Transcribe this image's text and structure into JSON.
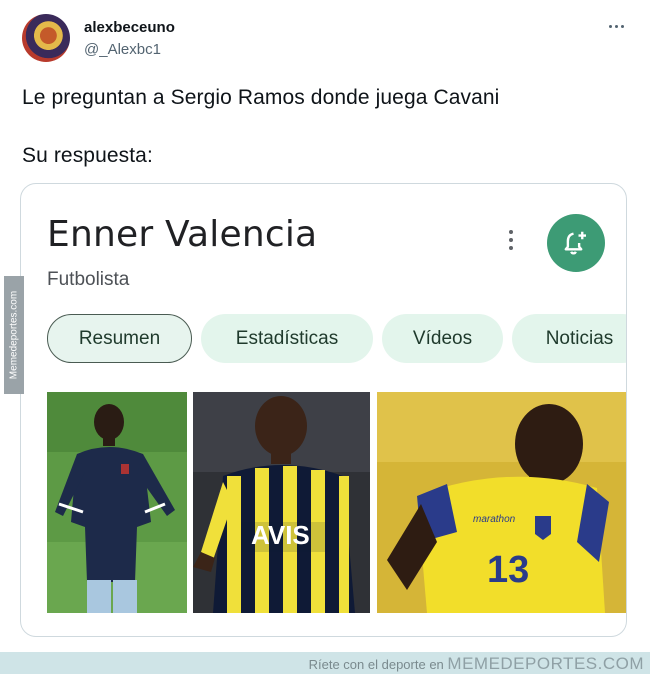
{
  "author": {
    "name": "alexbeceuno",
    "handle": "@_Alexbc1"
  },
  "tweet": {
    "line1": "Le preguntan a Sergio Ramos donde juega Cavani",
    "line2": "Su respuesta:"
  },
  "card": {
    "title": "Enner Valencia",
    "subtitle": "Futbolista",
    "tabs": [
      {
        "label": "Resumen",
        "active": true
      },
      {
        "label": "Estadísticas",
        "active": false
      },
      {
        "label": "Vídeos",
        "active": false
      },
      {
        "label": "Noticias",
        "active": false
      }
    ],
    "icons": {
      "more": "more-vert-icon",
      "follow": "bell-plus-icon"
    },
    "accent_color": "#3d9b75"
  },
  "images": [
    {
      "description_icon": "player-west-ham-photo"
    },
    {
      "description_icon": "player-fenerbahce-photo"
    },
    {
      "description_icon": "player-ecuador-photo"
    }
  ],
  "watermark": {
    "side_text": "Memedeportes.com",
    "footer_prefix": "Ríete con el deporte en",
    "footer_brand": "MEMEDEPORTES.COM"
  }
}
